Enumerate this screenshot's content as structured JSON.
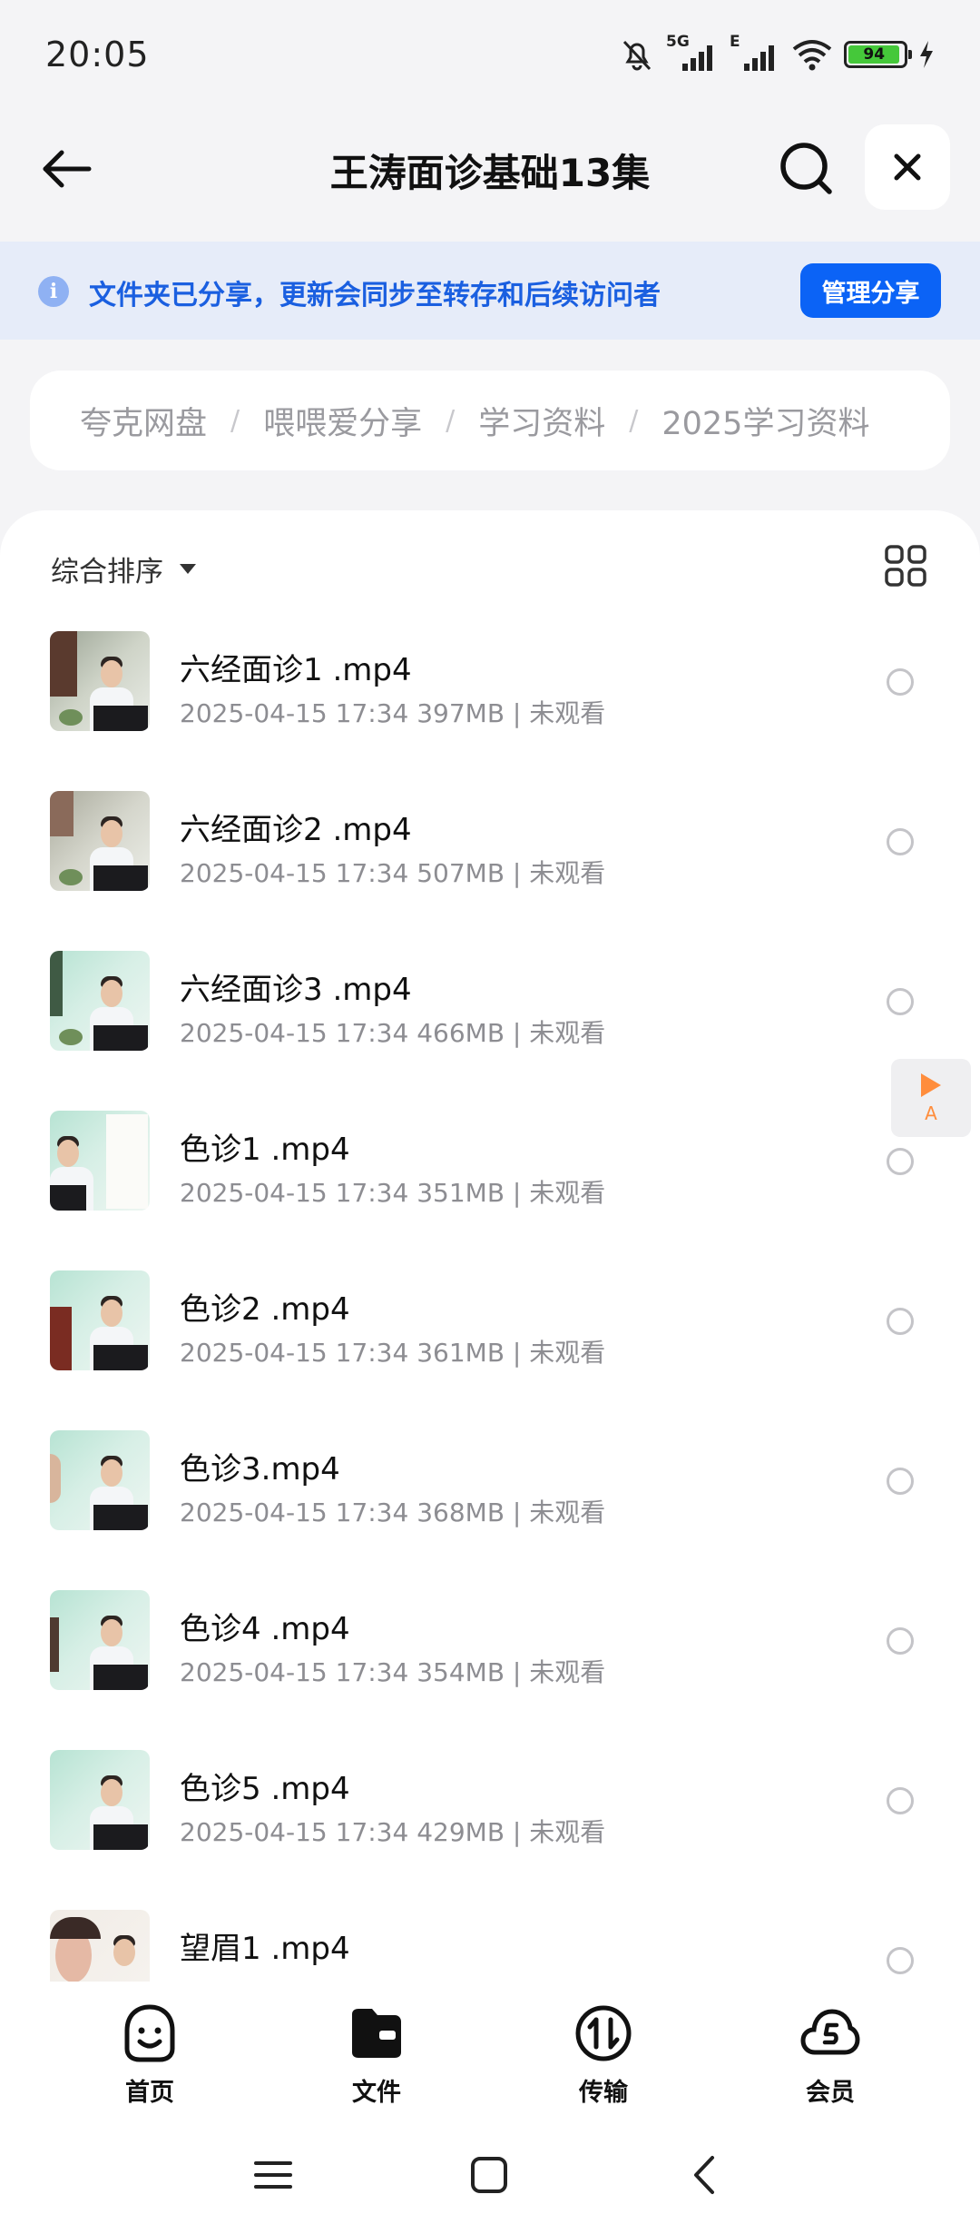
{
  "status_bar": {
    "time": "20:05",
    "network_label": "5G",
    "secondary_network_label": "E",
    "battery_level": "94",
    "icons": [
      "bell-muted-icon",
      "signal-icon",
      "signal-icon",
      "wifi-icon",
      "battery-icon",
      "charging-icon"
    ]
  },
  "header": {
    "title": "王涛面诊基础13集",
    "icons": [
      "back-arrow-icon",
      "search-icon",
      "close-icon"
    ]
  },
  "banner": {
    "info_icon_glyph": "i",
    "text": "文件夹已分享，更新会同步至转存和后续访问者",
    "manage_label": "管理分享"
  },
  "breadcrumb": {
    "items": [
      "夸克网盘",
      "喂喂爱分享",
      "学习资料",
      "2025学习资料"
    ],
    "separator": "/"
  },
  "toolbar": {
    "sort_label": "综合排序",
    "view_toggle_icon": "grid-view-icon"
  },
  "files": [
    {
      "name": "六经面诊1 .mp4",
      "meta": "2025-04-15 17:34  397MB | 未观看"
    },
    {
      "name": "六经面诊2 .mp4",
      "meta": "2025-04-15 17:34  507MB | 未观看"
    },
    {
      "name": "六经面诊3 .mp4",
      "meta": "2025-04-15 17:34  466MB | 未观看"
    },
    {
      "name": "色诊1 .mp4",
      "meta": "2025-04-15 17:34  351MB | 未观看"
    },
    {
      "name": "色诊2 .mp4",
      "meta": "2025-04-15 17:34  361MB | 未观看"
    },
    {
      "name": "色诊3.mp4",
      "meta": "2025-04-15 17:34  368MB | 未观看"
    },
    {
      "name": "色诊4 .mp4",
      "meta": "2025-04-15 17:34  354MB | 未观看"
    },
    {
      "name": "色诊5 .mp4",
      "meta": "2025-04-15 17:34  429MB | 未观看"
    },
    {
      "name": "望眉1 .mp4",
      "meta": ""
    }
  ],
  "floating": {
    "letter": "A",
    "icon": "play-icon",
    "accent": "#ff8d3c"
  },
  "bottom_nav": {
    "items": [
      {
        "label": "首页",
        "icon": "smiley-home-icon"
      },
      {
        "label": "文件",
        "icon": "folder-icon"
      },
      {
        "label": "传输",
        "icon": "transfer-icon"
      },
      {
        "label": "会员",
        "icon": "cloud-member-icon"
      }
    ]
  },
  "system_nav": {
    "icons": [
      "menu-icon",
      "home-square-icon",
      "back-chevron-icon"
    ]
  },
  "colors": {
    "accent": "#0b63f6",
    "banner_bg": "#e6ecf9",
    "banner_text": "#1a5fe0",
    "page_bg": "#f4f4f6"
  }
}
